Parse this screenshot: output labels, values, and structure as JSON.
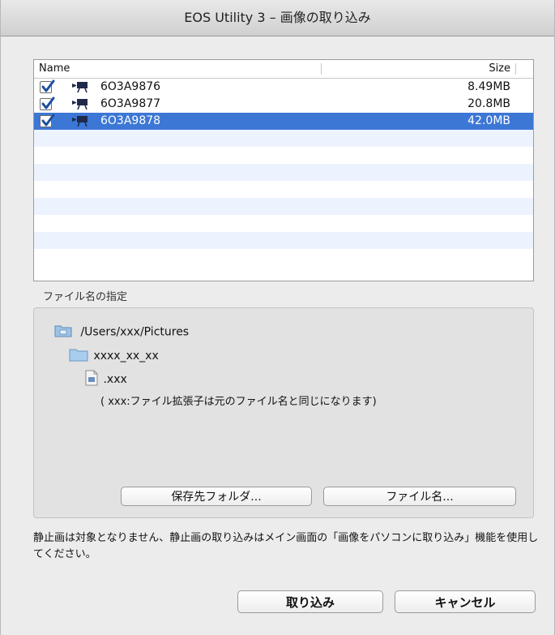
{
  "window": {
    "title": "EOS Utility 3 – 画像の取り込み"
  },
  "list": {
    "columns": {
      "name": "Name",
      "size": "Size"
    },
    "files": [
      {
        "name": "6O3A9876",
        "size": "8.49MB",
        "checked": true,
        "selected": false
      },
      {
        "name": "6O3A9877",
        "size": "20.8MB",
        "checked": true,
        "selected": false
      },
      {
        "name": "6O3A9878",
        "size": "42.0MB",
        "checked": true,
        "selected": true
      }
    ]
  },
  "filename_section": {
    "label": "ファイル名の指定",
    "destination_path": "/Users/xxx/Pictures",
    "folder_name": "xxxx_xx_xx",
    "file_extension": ".xxx",
    "note": "( xxx:ファイル拡張子は元のファイル名と同じになります)",
    "save_folder_button": "保存先フォルダ...",
    "filename_button": "ファイル名..."
  },
  "message": "静止画は対象となりません、静止画の取り込みはメイン画面の「画像をパソコンに取り込み」機能を使用してください。",
  "footer": {
    "import_button": "取り込み",
    "cancel_button": "キャンセル"
  },
  "colors": {
    "selection": "#3d77d6",
    "alt_row": "#edf3fe",
    "checkmark": "#1b4f9e"
  }
}
